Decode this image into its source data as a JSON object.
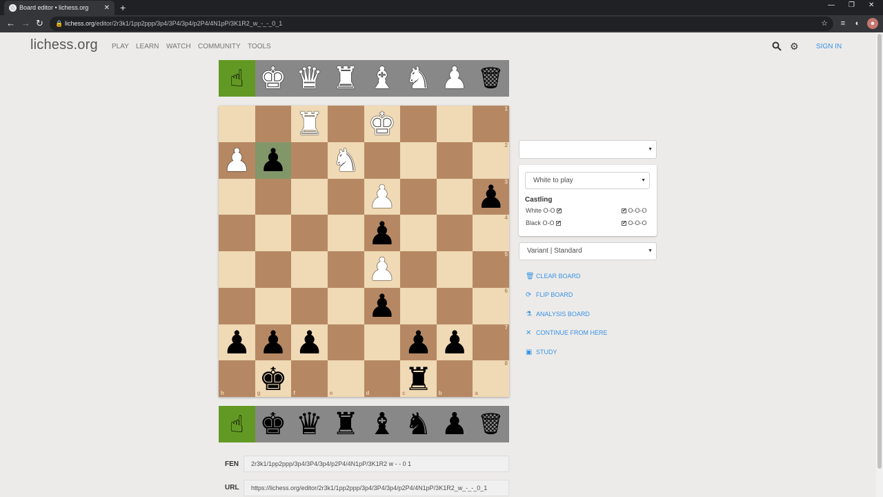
{
  "browser": {
    "tab_title": "Board editor • lichess.org",
    "tab_favicon": "♘",
    "url_host": "lichess.org",
    "url_path": "/editor/2r3k1/1pp2ppp/3p4/3P4/3p4/p2P4/4N1pP/3K1R2_w_-_-_0_1"
  },
  "site": {
    "logo": "lichess.org",
    "nav": [
      "PLAY",
      "LEARN",
      "WATCH",
      "COMMUNITY",
      "TOOLS"
    ],
    "sign_in": "SIGN IN"
  },
  "spare_top": [
    "hand",
    "♚",
    "♛",
    "♜",
    "♝",
    "♞",
    "♟",
    "trash"
  ],
  "spare_bottom": [
    "hand",
    "♚",
    "♛",
    "♜",
    "♝",
    "♞",
    "♟",
    "trash"
  ],
  "board": {
    "files": [
      "h",
      "g",
      "f",
      "e",
      "d",
      "c",
      "b",
      "a"
    ],
    "ranks": [
      "1",
      "2",
      "3",
      "4",
      "5",
      "6",
      "7",
      "8"
    ],
    "rows": [
      [
        "",
        "",
        "wR",
        "",
        "wK",
        "",
        "",
        ""
      ],
      [
        "wP",
        "bP",
        "",
        "wN",
        "",
        "",
        "",
        ""
      ],
      [
        "",
        "",
        "",
        "",
        "wP",
        "",
        "",
        "bP"
      ],
      [
        "",
        "",
        "",
        "",
        "bP",
        "",
        "",
        ""
      ],
      [
        "",
        "",
        "",
        "",
        "wP",
        "",
        "",
        ""
      ],
      [
        "",
        "",
        "",
        "",
        "bP",
        "",
        "",
        ""
      ],
      [
        "bP",
        "bP",
        "bP",
        "",
        "",
        "bP",
        "bP",
        ""
      ],
      [
        "",
        "bK",
        "",
        "",
        "",
        "bR",
        "",
        ""
      ]
    ],
    "last_move_square": "g2"
  },
  "panel": {
    "position_select": "",
    "turn_select": "White to play",
    "castling_title": "Castling",
    "white_oo": "White O-O",
    "white_ooo": "O-O-O",
    "black_oo": "Black O-O",
    "black_ooo": "O-O-O",
    "variant": "Variant | Standard",
    "actions": [
      {
        "icon": "trash-icon",
        "glyph": "🗑",
        "label": "CLEAR BOARD"
      },
      {
        "icon": "flip-icon",
        "glyph": "⟳",
        "label": "FLIP BOARD"
      },
      {
        "icon": "flask-icon",
        "glyph": "⚗",
        "label": "ANALYSIS BOARD"
      },
      {
        "icon": "swords-icon",
        "glyph": "✕",
        "label": "CONTINUE FROM HERE"
      },
      {
        "icon": "study-icon",
        "glyph": "▣",
        "label": "STUDY"
      }
    ]
  },
  "fen": {
    "label": "FEN",
    "value": "2r3k1/1pp2ppp/3p4/3P4/3p4/p2P4/4N1pP/3K1R2 w - - 0 1"
  },
  "url": {
    "label": "URL",
    "value": "https://lichess.org/editor/2r3k1/1pp2ppp/3p4/3P4/3p4/p2P4/4N1pP/3K1R2_w_-_-_0_1"
  },
  "colors": {
    "light_square": "#f0d9b5",
    "dark_square": "#b58863",
    "highlight": "#829769",
    "selected_tool": "#629924",
    "link": "#3692e7"
  }
}
